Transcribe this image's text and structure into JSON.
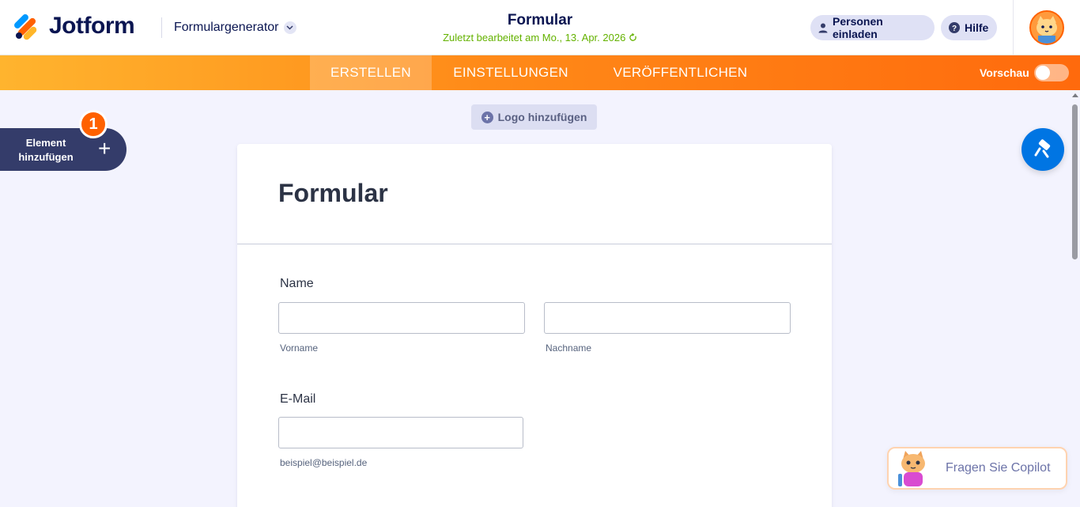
{
  "header": {
    "brand": "Jotform",
    "generator_label": "Formulargenerator",
    "form_title": "Formular",
    "last_edited": "Zuletzt bearbeitet am Mo., 13. Apr. 2026",
    "invite_label": "Personen einladen",
    "help_label": "Hilfe"
  },
  "nav": {
    "tabs": [
      {
        "label": "ERSTELLEN",
        "active": true
      },
      {
        "label": "EINSTELLUNGEN",
        "active": false
      },
      {
        "label": "VERÖFFENTLICHEN",
        "active": false
      }
    ],
    "preview_label": "Vorschau",
    "preview_on": false
  },
  "sidebar": {
    "add_element_label": "Element hinzufügen",
    "badge": "1"
  },
  "canvas": {
    "add_logo_label": "Logo hinzufügen"
  },
  "form": {
    "heading": "Formular",
    "name_label": "Name",
    "first_name_sublabel": "Vorname",
    "last_name_sublabel": "Nachname",
    "email_label": "E-Mail",
    "email_sublabel": "beispiel@beispiel.de"
  },
  "copilot": {
    "label": "Fragen Sie Copilot"
  },
  "colors": {
    "brand_navy": "#0a1551",
    "accent_orange": "#ff6100",
    "accent_blue": "#0075e3",
    "success_green": "#64b200"
  }
}
